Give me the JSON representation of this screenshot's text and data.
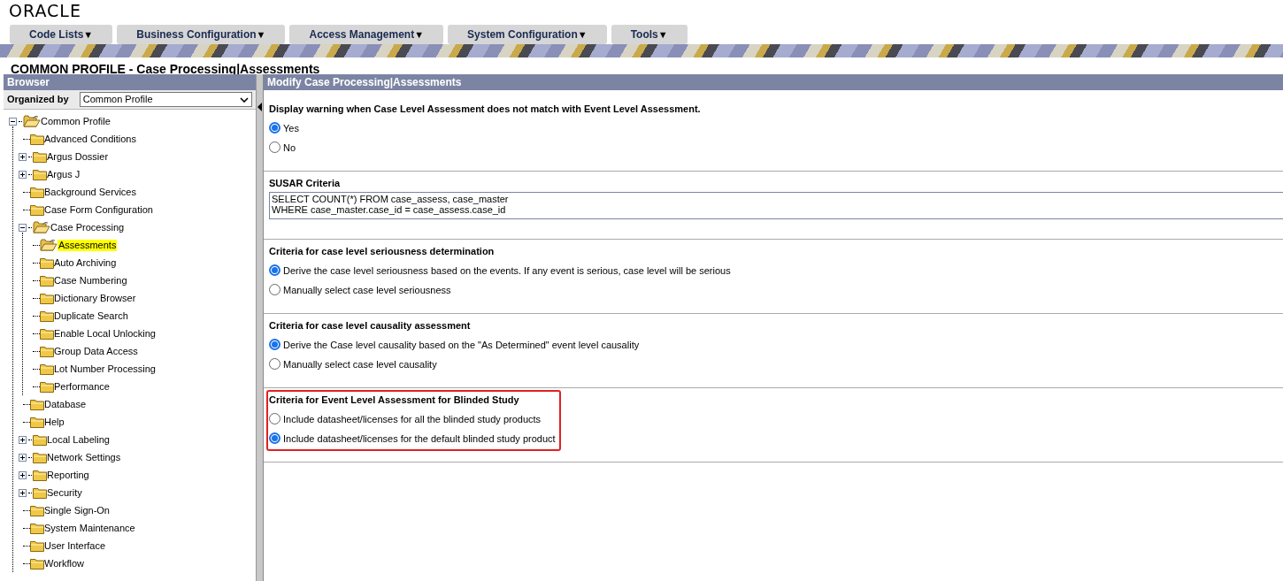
{
  "logo": "ORACLE",
  "menu": [
    {
      "label": "Code Lists",
      "caret": "▼"
    },
    {
      "label": "Business Configuration",
      "caret": "▼"
    },
    {
      "label": "Access Management",
      "caret": "▼"
    },
    {
      "label": "System Configuration",
      "caret": "▼"
    },
    {
      "label": "Tools",
      "caret": "▼"
    }
  ],
  "page_title": "COMMON PROFILE - Case Processing|Assessments",
  "browser": {
    "title": "Browser",
    "organized_by_label": "Organized by",
    "organized_by_value": "Common Profile",
    "tree": [
      {
        "label": "Common Profile",
        "kind": "expanded",
        "selected": false,
        "children": [
          {
            "label": "Advanced Conditions",
            "kind": "leaf",
            "selected": false
          },
          {
            "label": "Argus Dossier",
            "kind": "collapsed",
            "selected": false
          },
          {
            "label": "Argus J",
            "kind": "collapsed",
            "selected": false
          },
          {
            "label": "Background Services",
            "kind": "leaf",
            "selected": false
          },
          {
            "label": "Case Form Configuration",
            "kind": "leaf",
            "selected": false
          },
          {
            "label": "Case Processing",
            "kind": "expanded",
            "selected": false,
            "children": [
              {
                "label": "Assessments",
                "kind": "leaf",
                "selected": true
              },
              {
                "label": "Auto Archiving",
                "kind": "leaf",
                "selected": false
              },
              {
                "label": "Case Numbering",
                "kind": "leaf",
                "selected": false
              },
              {
                "label": "Dictionary Browser",
                "kind": "leaf",
                "selected": false
              },
              {
                "label": "Duplicate Search",
                "kind": "leaf",
                "selected": false
              },
              {
                "label": "Enable Local Unlocking",
                "kind": "leaf",
                "selected": false
              },
              {
                "label": "Group Data Access",
                "kind": "leaf",
                "selected": false
              },
              {
                "label": "Lot Number Processing",
                "kind": "leaf",
                "selected": false
              },
              {
                "label": "Performance",
                "kind": "leaf",
                "selected": false
              }
            ]
          },
          {
            "label": "Database",
            "kind": "leaf",
            "selected": false
          },
          {
            "label": "Help",
            "kind": "leaf",
            "selected": false
          },
          {
            "label": "Local Labeling",
            "kind": "collapsed",
            "selected": false
          },
          {
            "label": "Network Settings",
            "kind": "collapsed",
            "selected": false
          },
          {
            "label": "Reporting",
            "kind": "collapsed",
            "selected": false
          },
          {
            "label": "Security",
            "kind": "collapsed",
            "selected": false
          },
          {
            "label": "Single Sign-On",
            "kind": "leaf",
            "selected": false
          },
          {
            "label": "System Maintenance",
            "kind": "leaf",
            "selected": false
          },
          {
            "label": "User Interface",
            "kind": "leaf",
            "selected": false
          },
          {
            "label": "Workflow",
            "kind": "leaf",
            "selected": false
          }
        ]
      }
    ]
  },
  "form": {
    "title": "Modify Case Processing|Assessments",
    "sections": [
      {
        "kind": "radios",
        "heading": "Display warning when Case Level Assessment does not match with Event Level Assessment.",
        "highlighted": false,
        "options": [
          {
            "label": "Yes",
            "selected": true
          },
          {
            "label": "No",
            "selected": false
          }
        ]
      },
      {
        "kind": "text",
        "heading": "SUSAR Criteria",
        "highlighted": false,
        "lines": [
          "SELECT COUNT(*) FROM case_assess, case_master",
          "WHERE case_master.case_id = case_assess.case_id"
        ]
      },
      {
        "kind": "radios",
        "heading": "Criteria for case level seriousness determination",
        "highlighted": false,
        "options": [
          {
            "label": "Derive the case level seriousness based on the events. If any event is serious, case level will be serious",
            "selected": true
          },
          {
            "label": "Manually select case level seriousness",
            "selected": false
          }
        ]
      },
      {
        "kind": "radios",
        "heading": "Criteria for case level causality assessment",
        "highlighted": false,
        "options": [
          {
            "label": "Derive the Case level causality based on the \"As Determined\" event level causality",
            "selected": true
          },
          {
            "label": "Manually select case level causality",
            "selected": false
          }
        ]
      },
      {
        "kind": "radios",
        "heading": "Criteria for Event Level Assessment for Blinded Study",
        "highlighted": true,
        "options": [
          {
            "label": "Include datasheet/licenses for all the blinded study products",
            "selected": false
          },
          {
            "label": "Include datasheet/licenses for the default blinded study product",
            "selected": true
          }
        ]
      }
    ]
  }
}
